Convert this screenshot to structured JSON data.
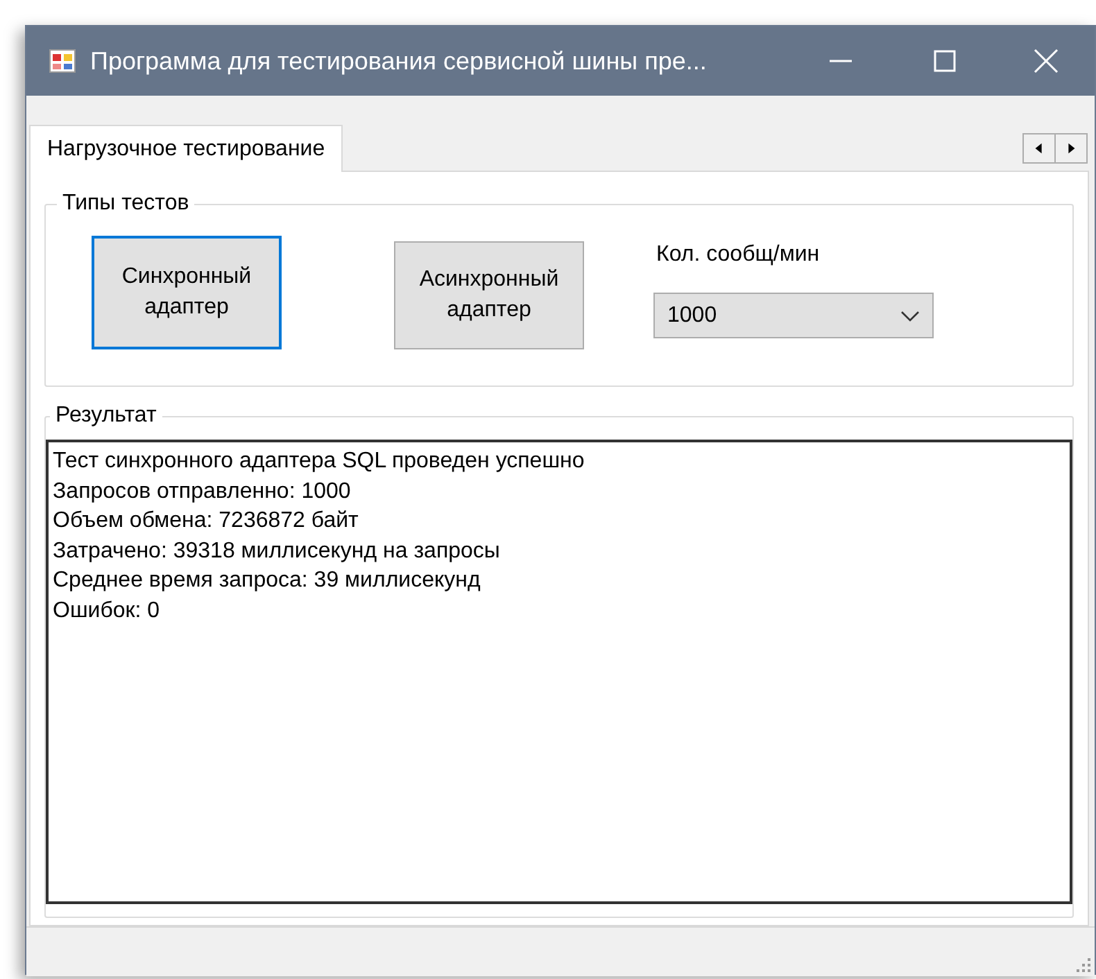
{
  "window": {
    "title": "Программа для тестирования сервисной шины пре..."
  },
  "tabs": [
    {
      "label": "Нагрузочное тестирование",
      "selected": true
    }
  ],
  "test_types": {
    "title": "Типы тестов",
    "buttons": [
      {
        "label": "Синхронный\nадаптер",
        "focused": true
      },
      {
        "label": "Асинхронный\nадаптер",
        "focused": false
      }
    ],
    "rate_label": "Кол. сообщ/мин",
    "rate_value": "1000"
  },
  "result": {
    "title": "Результат",
    "lines": [
      "Тест синхронного адаптера SQL проведен успешно",
      "Запросов отправленно: 1000",
      "Объем обмена: 7236872 байт",
      "Затрачено: 39318 миллисекунд на запросы",
      "Среднее время запроса: 39 миллисекунд",
      "Ошибок: 0"
    ]
  }
}
